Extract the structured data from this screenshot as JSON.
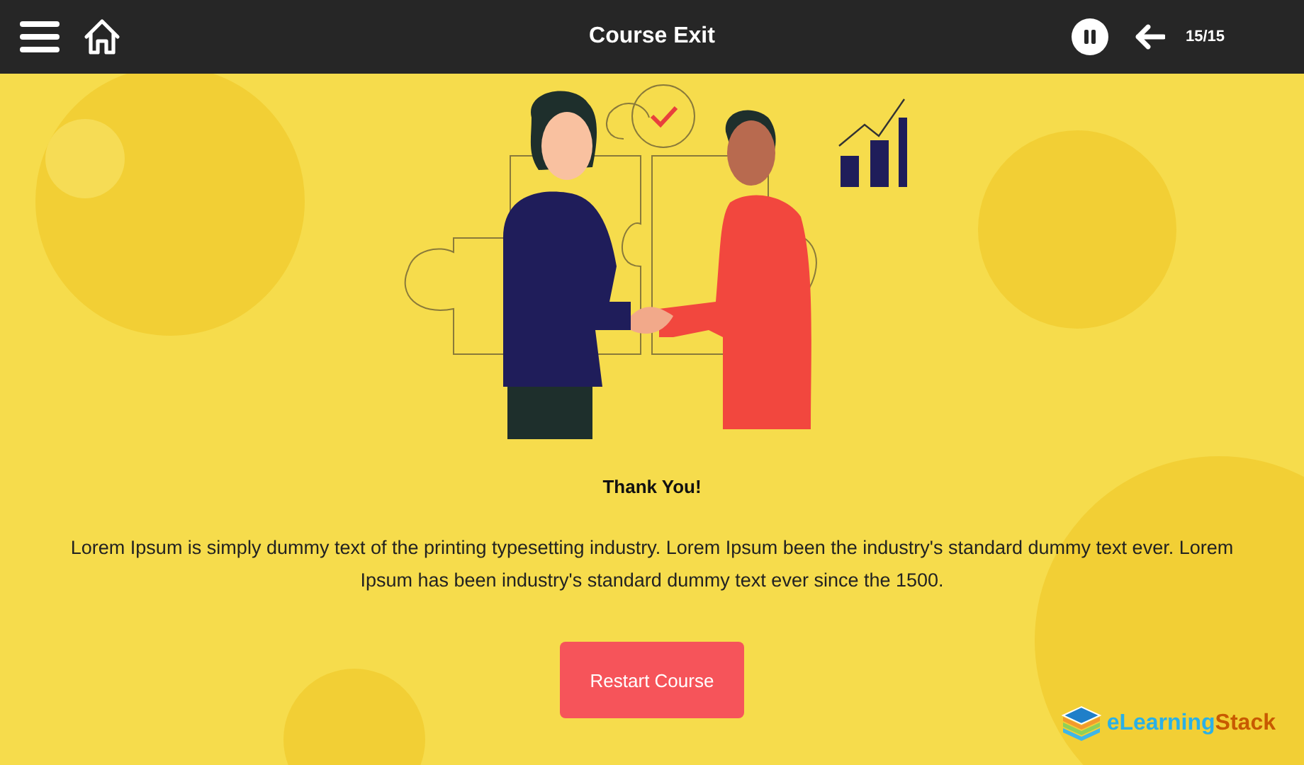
{
  "top_bar": {
    "title": "Course Exit",
    "page_counter": "15/15"
  },
  "heading": "Thank You!",
  "body_text": "Lorem Ipsum is simply dummy text of the printing typesetting industry. Lorem Ipsum been the industry's standard dummy text ever. Lorem Ipsum has been industry's standard dummy text ever since the 1500.",
  "button": {
    "label": "Restart Course"
  },
  "logo": {
    "parts": [
      "eLearning",
      "Stack"
    ]
  }
}
